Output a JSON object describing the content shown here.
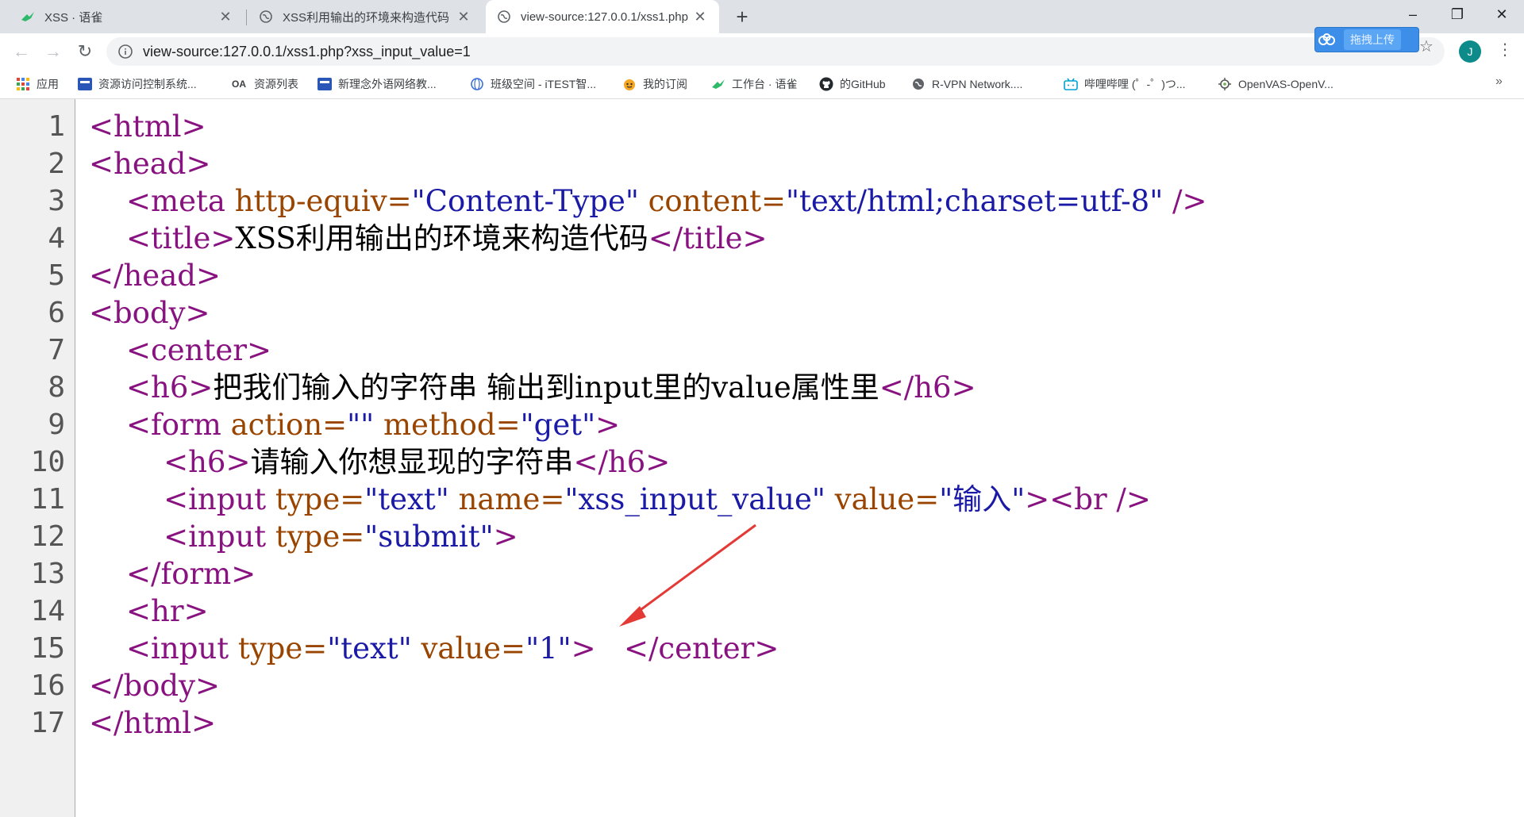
{
  "tabs": [
    {
      "title": "XSS · 语雀",
      "favicon": "yuque-icon"
    },
    {
      "title": "XSS利用输出的环境来构造代码",
      "favicon": "globe-icon"
    },
    {
      "title": "view-source:127.0.0.1/xss1.php",
      "favicon": "globe-icon",
      "active": true
    }
  ],
  "address_bar": {
    "url_prefix": "view-source:",
    "url_host": "127.0.0.1",
    "url_path": "/xss1.php?xss_input_value=1"
  },
  "extension": {
    "upload_label": "拖拽上传"
  },
  "profile": {
    "initial": "J"
  },
  "bookmarks": [
    {
      "label": "应用",
      "icon": "apps-grid-icon"
    },
    {
      "label": "资源访问控制系统...",
      "icon": "bookmark-icon"
    },
    {
      "label": "资源列表",
      "icon": "oa-icon",
      "icon_text": "OA"
    },
    {
      "label": "新理念外语网络教...",
      "icon": "bookmark-icon"
    },
    {
      "label": "班级空间 - iTEST智...",
      "icon": "globe-icon"
    },
    {
      "label": "我的订阅",
      "icon": "bilibili-face-icon"
    },
    {
      "label": "工作台 · 语雀",
      "icon": "yuque-icon"
    },
    {
      "label": "的GitHub",
      "icon": "github-icon"
    },
    {
      "label": "R-VPN Network....",
      "icon": "globe-icon"
    },
    {
      "label": "哔哩哔哩 (゜-゜)つ...",
      "icon": "bilibili-icon"
    },
    {
      "label": "OpenVAS-OpenV...",
      "icon": "openvas-icon"
    }
  ],
  "source_lines": [
    {
      "n": "1",
      "parts": [
        [
          "tag",
          "<html>"
        ]
      ]
    },
    {
      "n": "2",
      "parts": [
        [
          "tag",
          "<head>"
        ]
      ]
    },
    {
      "n": "3",
      "parts": [
        [
          "txt",
          "    "
        ],
        [
          "tag",
          "<meta "
        ],
        [
          "attr",
          "http-equiv="
        ],
        [
          "val",
          "\"Content-Type\""
        ],
        [
          "attr",
          " content="
        ],
        [
          "val",
          "\"text/html;charset=utf-8\""
        ],
        [
          "tag",
          " />"
        ]
      ]
    },
    {
      "n": "4",
      "parts": [
        [
          "txt",
          "    "
        ],
        [
          "tag",
          "<title>"
        ],
        [
          "txt",
          "XSS利用输出的环境来构造代码"
        ],
        [
          "tag",
          "</title>"
        ]
      ]
    },
    {
      "n": "5",
      "parts": [
        [
          "tag",
          "</head>"
        ]
      ]
    },
    {
      "n": "6",
      "parts": [
        [
          "tag",
          "<body>"
        ]
      ]
    },
    {
      "n": "7",
      "parts": [
        [
          "txt",
          "    "
        ],
        [
          "tag",
          "<center>"
        ]
      ]
    },
    {
      "n": "8",
      "parts": [
        [
          "txt",
          "    "
        ],
        [
          "tag",
          "<h6>"
        ],
        [
          "txt",
          "把我们输入的字符串 输出到input里的value属性里"
        ],
        [
          "tag",
          "</h6>"
        ]
      ]
    },
    {
      "n": "9",
      "parts": [
        [
          "txt",
          "    "
        ],
        [
          "tag",
          "<form "
        ],
        [
          "attr",
          "action="
        ],
        [
          "val",
          "\"\""
        ],
        [
          "attr",
          " method="
        ],
        [
          "val",
          "\"get\""
        ],
        [
          "tag",
          ">"
        ]
      ]
    },
    {
      "n": "10",
      "parts": [
        [
          "txt",
          "        "
        ],
        [
          "tag",
          "<h6>"
        ],
        [
          "txt",
          "请输入你想显现的字符串"
        ],
        [
          "tag",
          "</h6>"
        ]
      ]
    },
    {
      "n": "11",
      "parts": [
        [
          "txt",
          "        "
        ],
        [
          "tag",
          "<input "
        ],
        [
          "attr",
          "type="
        ],
        [
          "val",
          "\"text\""
        ],
        [
          "attr",
          " name="
        ],
        [
          "val",
          "\"xss_input_value\""
        ],
        [
          "attr",
          " value="
        ],
        [
          "val",
          "\"输入\""
        ],
        [
          "tag",
          "><br />"
        ]
      ]
    },
    {
      "n": "12",
      "parts": [
        [
          "txt",
          "        "
        ],
        [
          "tag",
          "<input "
        ],
        [
          "attr",
          "type="
        ],
        [
          "val",
          "\"submit\""
        ],
        [
          "tag",
          ">"
        ]
      ]
    },
    {
      "n": "13",
      "parts": [
        [
          "txt",
          "    "
        ],
        [
          "tag",
          "</form>"
        ]
      ]
    },
    {
      "n": "14",
      "parts": [
        [
          "txt",
          "    "
        ],
        [
          "tag",
          "<hr>"
        ]
      ]
    },
    {
      "n": "15",
      "parts": [
        [
          "txt",
          "    "
        ],
        [
          "tag",
          "<input "
        ],
        [
          "attr",
          "type="
        ],
        [
          "val",
          "\"text\""
        ],
        [
          "attr",
          " value="
        ],
        [
          "val",
          "\"1\""
        ],
        [
          "tag",
          ">"
        ],
        [
          "txt",
          "   "
        ],
        [
          "tag",
          "</center>"
        ]
      ]
    },
    {
      "n": "16",
      "parts": [
        [
          "tag",
          "</body>"
        ]
      ]
    },
    {
      "n": "17",
      "parts": [
        [
          "tag",
          "</html>"
        ]
      ]
    }
  ],
  "colors": {
    "tag": "#881280",
    "attr": "#994500",
    "value": "#1a1aa6",
    "annotation_arrow": "#e53935"
  }
}
